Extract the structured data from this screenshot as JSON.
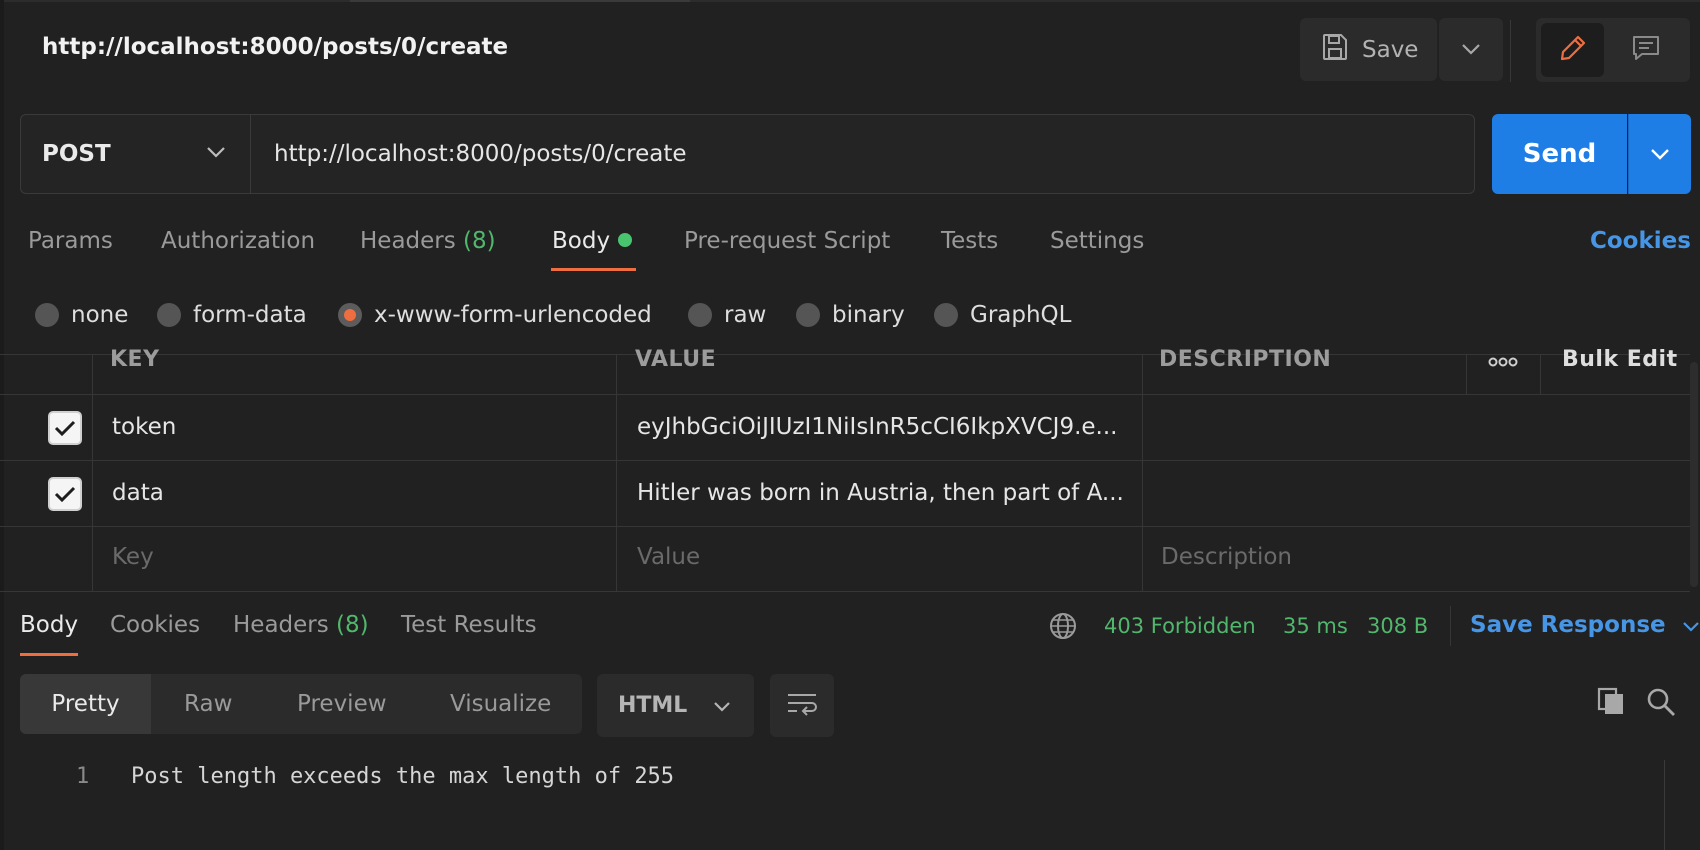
{
  "request": {
    "title": "http://localhost:8000/posts/0/create",
    "save_label": "Save",
    "method": "POST",
    "url": "http://localhost:8000/posts/0/create",
    "send_label": "Send"
  },
  "request_tabs": {
    "params": "Params",
    "authorization": "Authorization",
    "headers": "Headers",
    "headers_count": "(8)",
    "body": "Body",
    "prerequest": "Pre-request Script",
    "tests": "Tests",
    "settings": "Settings",
    "cookies": "Cookies",
    "active": "Body"
  },
  "body_types": {
    "none": "none",
    "form_data": "form-data",
    "urlencoded": "x-www-form-urlencoded",
    "raw": "raw",
    "binary": "binary",
    "graphql": "GraphQL",
    "selected": "x-www-form-urlencoded"
  },
  "params_table": {
    "headers": {
      "key": "KEY",
      "value": "VALUE",
      "description": "DESCRIPTION",
      "bulk_edit": "Bulk Edit"
    },
    "rows": [
      {
        "checked": true,
        "key": "token",
        "value": "eyJhbGciOiJIUzI1NiIsInR5cCI6IkpXVCJ9.e...",
        "description": ""
      },
      {
        "checked": true,
        "key": "data",
        "value": "Hitler was born in Austria, then part of A...",
        "description": ""
      }
    ],
    "placeholders": {
      "key": "Key",
      "value": "Value",
      "description": "Description"
    }
  },
  "response": {
    "tabs": {
      "body": "Body",
      "cookies": "Cookies",
      "headers": "Headers",
      "headers_count": "(8)",
      "test_results": "Test Results"
    },
    "status": "403 Forbidden",
    "time": "35 ms",
    "size": "308 B",
    "save_response": "Save Response",
    "view_tabs": {
      "pretty": "Pretty",
      "raw": "Raw",
      "preview": "Preview",
      "visualize": "Visualize"
    },
    "format": "HTML",
    "code": {
      "line_number": "1",
      "text": "Post length exceeds the max length of 255"
    }
  },
  "colors": {
    "background": "#212121",
    "accent_blue": "#1f7ee6",
    "link_blue": "#4795e5",
    "tab_underline": "#ee6e3f",
    "status_green": "#51b76c"
  },
  "icons": [
    "save-icon",
    "chevron-down-icon",
    "pencil-icon",
    "comment-icon",
    "globe-icon",
    "wrap-lines-icon",
    "copy-icon",
    "search-icon",
    "more-icon"
  ]
}
